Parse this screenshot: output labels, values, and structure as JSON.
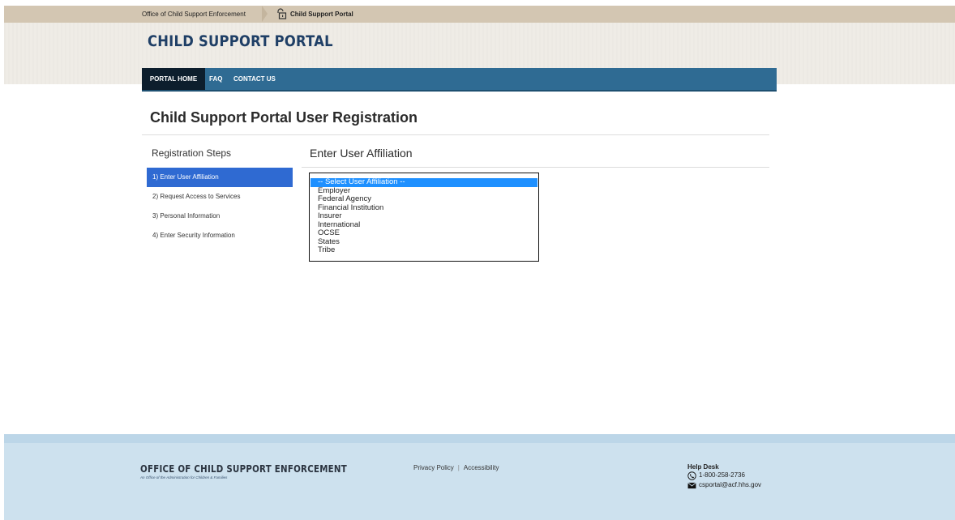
{
  "breadcrumb": {
    "items": [
      "Office of Child Support Enforcement",
      "Child Support Portal"
    ]
  },
  "brand": {
    "title": "CHILD SUPPORT PORTAL"
  },
  "nav": {
    "items": [
      {
        "label": "PORTAL HOME"
      },
      {
        "label": "FAQ"
      },
      {
        "label": "CONTACT US"
      }
    ]
  },
  "page": {
    "title": "Child Support Portal User Registration"
  },
  "steps": {
    "title": "Registration Steps",
    "items": [
      {
        "label": "1) Enter User Affiliation",
        "active": true
      },
      {
        "label": "2) Request Access to Services",
        "active": false
      },
      {
        "label": "3) Personal Information",
        "active": false
      },
      {
        "label": "4) Enter Security Information",
        "active": false
      }
    ]
  },
  "affiliation": {
    "title": "Enter User Affiliation",
    "selected": "-- Select User Affiliation --",
    "options": [
      "-- Select User Affiliation --",
      "Employer",
      "Federal Agency",
      "Financial Institution",
      "Insurer",
      "International",
      "OCSE",
      "States",
      "Tribe"
    ]
  },
  "footer": {
    "logo": "OFFICE OF CHILD SUPPORT ENFORCEMENT",
    "logo_subtitle": "An Office of the Administration for Children & Families",
    "links": [
      "Privacy Policy",
      "Accessibility"
    ],
    "separator": "|",
    "help_desk": {
      "heading": "Help Desk",
      "phone": "1-800-258-2736",
      "email": "csportal@acf.hhs.gov"
    }
  },
  "colors": {
    "nav": "#2f6b93",
    "nav_active": "#0d1e2d",
    "step_active": "#2f6ad2",
    "brand": "#1f3f66",
    "footer": "#cde1ee",
    "crumbbar": "#d3c6b2"
  },
  "icons": [
    "lock-icon",
    "phone-icon",
    "mail-icon"
  ]
}
